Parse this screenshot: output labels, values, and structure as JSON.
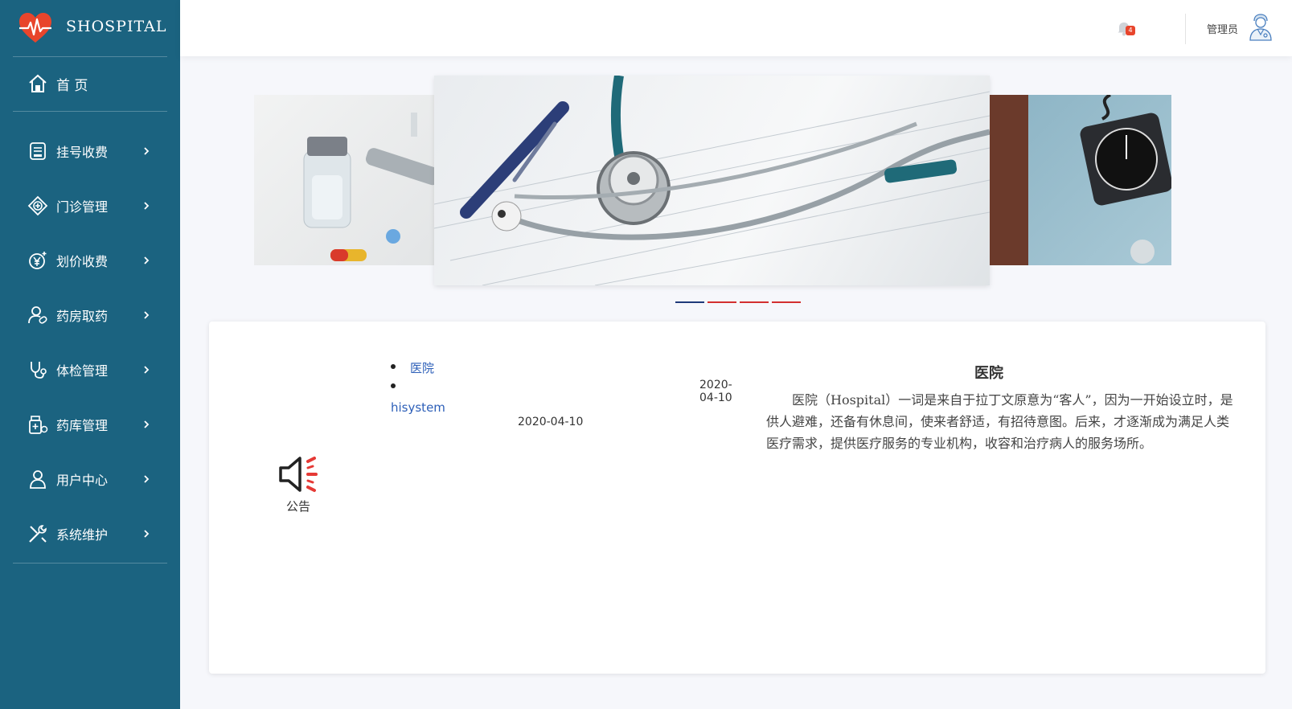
{
  "brand": {
    "title": "SHOSPITAL",
    "logo_icon": "heart-pulse-icon",
    "logo_color": "#e8452c"
  },
  "sidebar": {
    "background": "#1b6380",
    "home": {
      "label": "首 页",
      "icon": "home-icon"
    },
    "items": [
      {
        "label": "挂号收费",
        "icon": "registration-icon"
      },
      {
        "label": "门诊管理",
        "icon": "clinic-icon"
      },
      {
        "label": "划价收费",
        "icon": "yen-icon"
      },
      {
        "label": "药房取药",
        "icon": "pharmacy-icon"
      },
      {
        "label": "体检管理",
        "icon": "stethoscope-icon"
      },
      {
        "label": "药库管理",
        "icon": "medicine-store-icon"
      },
      {
        "label": "用户中心",
        "icon": "user-icon"
      },
      {
        "label": "系统维护",
        "icon": "tools-icon"
      }
    ]
  },
  "header": {
    "notification_count": "4",
    "user_name": "管理员",
    "avatar_icon": "doctor-avatar-icon"
  },
  "carousel": {
    "slides": [
      "medicine-vial-image",
      "stethoscope-image",
      "blood-pressure-image"
    ],
    "active_index": 0,
    "indicator_count": 4
  },
  "notice": {
    "label": "公告",
    "icon": "speaker-icon",
    "items": [
      {
        "title": "医院",
        "date": "2020-04-10"
      },
      {
        "title": "hisystem",
        "date": "2020-04-10"
      }
    ]
  },
  "article": {
    "title": "医院",
    "body": "医院（Hospital）一词是来自于拉丁文原意为“客人”，因为一开始设立时，是供人避难，还备有休息间，使来者舒适，有招待意图。后来，才逐渐成为满足人类医疗需求，提供医疗服务的专业机构，收容和治疗病人的服务场所。"
  }
}
